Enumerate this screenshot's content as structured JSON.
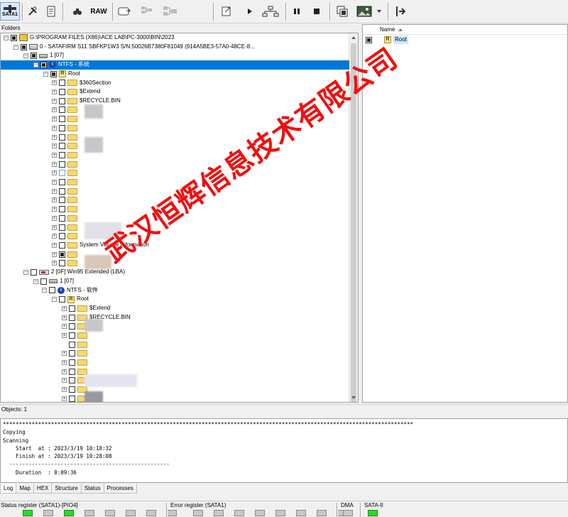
{
  "toolbar": {
    "sata_label": "SATA1",
    "raw_label": "RAW"
  },
  "folders": {
    "header": "Folders",
    "tree": [
      {
        "text": "G:\\PROGRAM FILES (X86)\\ACE LAB\\PC-3000\\BIN\\2023"
      },
      {
        "text": "0 - SATAFIRM   S11 SBFKP1W3 S/N:50026B7380F81049  (914A5BE3-57A0-48CE-8..."
      },
      {
        "text": "1 [07]"
      },
      {
        "text": "NTFS - 系统"
      },
      {
        "text": "Root"
      },
      {
        "text": "$360Section"
      },
      {
        "text": "$Extend"
      },
      {
        "text": "$RECYCLE.BIN"
      },
      {
        "text": "System Volume Information"
      },
      {
        "text": "2 [0F] Win95 Extended  (LBA)"
      },
      {
        "text": "1 [07]"
      },
      {
        "text": "NTFS - 软件"
      },
      {
        "text": "Root"
      },
      {
        "text": "$Extend"
      },
      {
        "text": "$RECYCLE.BIN"
      }
    ]
  },
  "right_pane": {
    "column_name": "Name",
    "item": "Root"
  },
  "status": {
    "objects": "Objects: 1"
  },
  "log": {
    "lines": [
      "********************************************************************************************************************************",
      "Copying",
      "Scanning",
      "    Start  at : 2023/3/19 10:18:32",
      "    Finish at : 2023/3/19 10:28:08",
      "  --------------------------------------------------",
      "    Duration  : 0:09:36"
    ]
  },
  "tabs": [
    "Log",
    "Map",
    "HEX",
    "Structure",
    "Status",
    "Processes"
  ],
  "registers": {
    "status_label": "Status register (SATA1)-[PIO4]",
    "error_label": "Error register (SATA1)",
    "dma_label": "DMA",
    "sata_label": "SATA-II",
    "status_leds": [
      1,
      0,
      1,
      0,
      0,
      0,
      0,
      0
    ],
    "error_leds": [
      0,
      0,
      0,
      0,
      0,
      0,
      0,
      0
    ],
    "dma_led": 0,
    "sata_led": 1
  },
  "watermark": "武汉恒辉信息技术有限公司",
  "colors": {
    "selection": "#0078d7",
    "led_on": "#22e022",
    "watermark": "#f01010"
  }
}
